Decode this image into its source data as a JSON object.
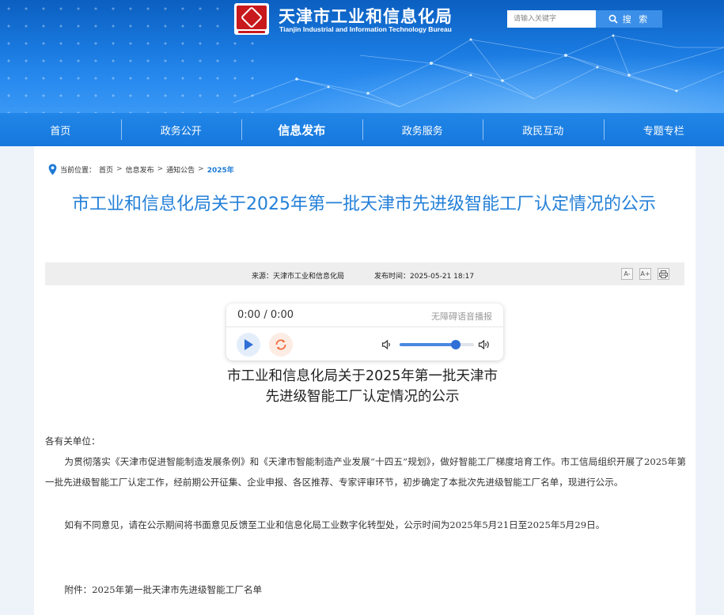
{
  "header": {
    "site_title": "天津市工业和信息化局",
    "site_subtitle": "Tianjin Industrial and Information Technology Bureau",
    "logo_icon": "tianjin-emblem-logo",
    "search": {
      "placeholder": "请输入关键字",
      "button_label": "搜 索"
    }
  },
  "nav": {
    "items": [
      {
        "label": "首页"
      },
      {
        "label": "政务公开"
      },
      {
        "label": "信息发布",
        "active": true
      },
      {
        "label": "政务服务"
      },
      {
        "label": "政民互动"
      },
      {
        "label": "专题专栏"
      }
    ]
  },
  "breadcrumb": {
    "prefix": "当前位置：",
    "items": [
      "首页",
      "信息发布",
      "通知公告"
    ],
    "separator": ">",
    "current": "2025年"
  },
  "article": {
    "title": "市工业和信息化局关于2025年第一批天津市先进级智能工厂认定情况的公示",
    "source": "来源：天津市工业和信息化局",
    "publish_time": "发布时间：2025-05-21 18:17",
    "tools": [
      "A-",
      "A+",
      "print"
    ]
  },
  "player": {
    "time": "0:00 / 0:00",
    "label": "无障碍语音播报",
    "volume": 0.75
  },
  "body": {
    "title_line1": "市工业和信息化局关于2025年第一批天津市",
    "title_line2": "先进级智能工厂认定情况的公示",
    "greeting": "各有关单位：",
    "para1": "为贯彻落实《天津市促进智能制造发展条例》和《天津市智能制造产业发展“十四五”规划》，做好智能工厂梯度培育工作。市工信局组织开展了2025年第一批先进级智能工厂认定工作，经前期公开征集、企业申报、各区推荐、专家评审环节，初步确定了本批次先进级智能工厂名单，现进行公示。",
    "para2": "如有不同意见，请在公示期间将书面意见反馈至工业和信息化局工业数字化转型处，公示时间为2025年5月21日至2025年5月29日。",
    "attachment": "附件：2025年第一批天津市先进级智能工厂名单"
  },
  "colors": {
    "brand_blue": "#1677dc",
    "title_blue": "#2480d8",
    "accent_orange": "#f06a3a"
  }
}
